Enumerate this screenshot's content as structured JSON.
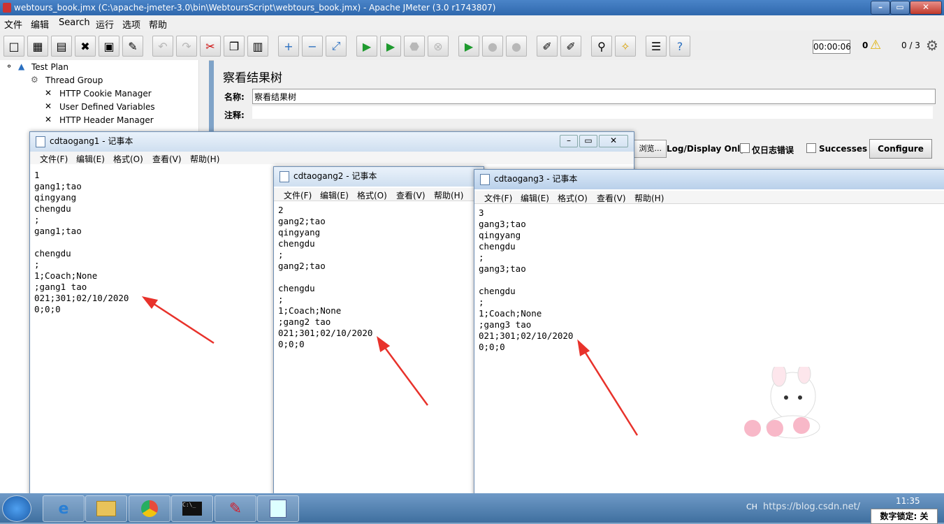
{
  "jmeter": {
    "title": "webtours_book.jmx (C:\\apache-jmeter-3.0\\bin\\WebtoursScript\\webtours_book.jmx) - Apache JMeter (3.0 r1743807)",
    "menu": [
      "文件",
      "编辑",
      "Search",
      "运行",
      "选项",
      "帮助"
    ],
    "timer": "00:00:06",
    "warnings": "0",
    "threads": "0 / 3",
    "tree": [
      "Test Plan",
      "Thread Group",
      "HTTP Cookie Manager",
      "User Defined Variables",
      "HTTP Header Manager"
    ],
    "panel": {
      "title": "察看结果树",
      "name_label": "名称:",
      "name_value": "察看结果树",
      "comment_label": "注释:",
      "log_display_only": "Log/Display Only:",
      "errors_only": "仅日志错误",
      "successes": "Successes",
      "configure": "Configure",
      "browse": "浏览..."
    }
  },
  "notepad1": {
    "title": "cdtaogang1 - 记事本",
    "menu": [
      "文件(F)",
      "编辑(E)",
      "格式(O)",
      "查看(V)",
      "帮助(H)"
    ],
    "lines": [
      "1",
      "gang1;tao",
      "qingyang",
      "chengdu",
      ";",
      "gang1;tao",
      "",
      "chengdu",
      ";",
      "1;Coach;None",
      ";gang1 tao",
      "021;301;02/10/2020",
      "0;0;0"
    ]
  },
  "notepad2": {
    "title": "cdtaogang2 - 记事本",
    "menu": [
      "文件(F)",
      "编辑(E)",
      "格式(O)",
      "查看(V)",
      "帮助(H)"
    ],
    "lines": [
      "2",
      "gang2;tao",
      "qingyang",
      "chengdu",
      ";",
      "gang2;tao",
      "",
      "chengdu",
      ";",
      "1;Coach;None",
      ";gang2 tao",
      "021;301;02/10/2020",
      "0;0;0"
    ]
  },
  "notepad3": {
    "title": "cdtaogang3 - 记事本",
    "menu": [
      "文件(F)",
      "编辑(E)",
      "格式(O)",
      "查看(V)",
      "帮助(H)"
    ],
    "lines": [
      "3",
      "gang3;tao",
      "qingyang",
      "chengdu",
      ";",
      "gang3;tao",
      "",
      "chengdu",
      ";",
      "1;Coach;None",
      ";gang3 tao",
      "021;301;02/10/2020",
      "0;0;0"
    ]
  },
  "taskbar": {
    "clock": "11:35",
    "ime_status": "数字锁定: 关",
    "lang": "CH",
    "watermark": "https://blog.csdn.net/"
  },
  "colors": {
    "arrow": "#e8322b",
    "title_bar": "#3a73b6"
  }
}
